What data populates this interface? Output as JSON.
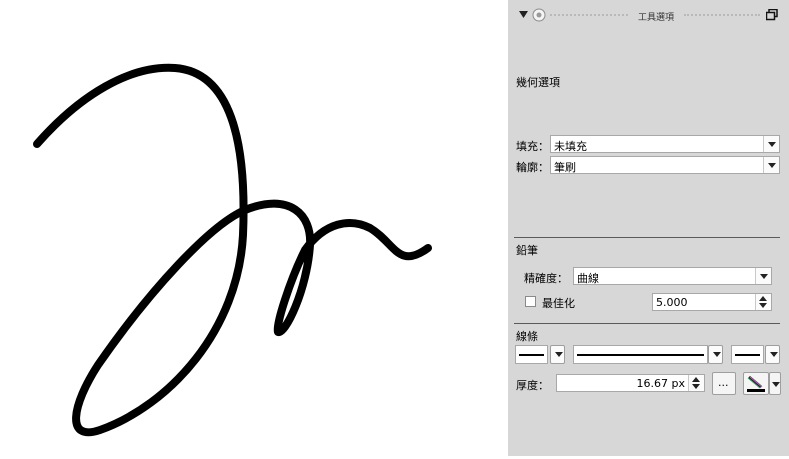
{
  "panel": {
    "title": "工具選項",
    "section_geometry": "幾何選項",
    "fill_label": "填充：",
    "fill_value": "未填充",
    "outline_label": "輪廓：",
    "outline_value": "筆刷",
    "pencil_header": "鉛筆",
    "precision_label": "精確度：",
    "precision_value": "曲線",
    "optimize_label": "最佳化",
    "optimize_checked": false,
    "optimize_value": "5.000",
    "lines_header": "線條",
    "thickness_label": "厚度：",
    "thickness_value": "16.67 px",
    "more_button": "..."
  },
  "colors": {
    "panel_bg": "#d7d7d7",
    "canvas_bg": "#ffffff",
    "stroke": "#000000"
  },
  "icons": [
    "collapse-triangle-icon",
    "tool-icon",
    "float-window-icon",
    "stroke-color-picker-icon"
  ]
}
